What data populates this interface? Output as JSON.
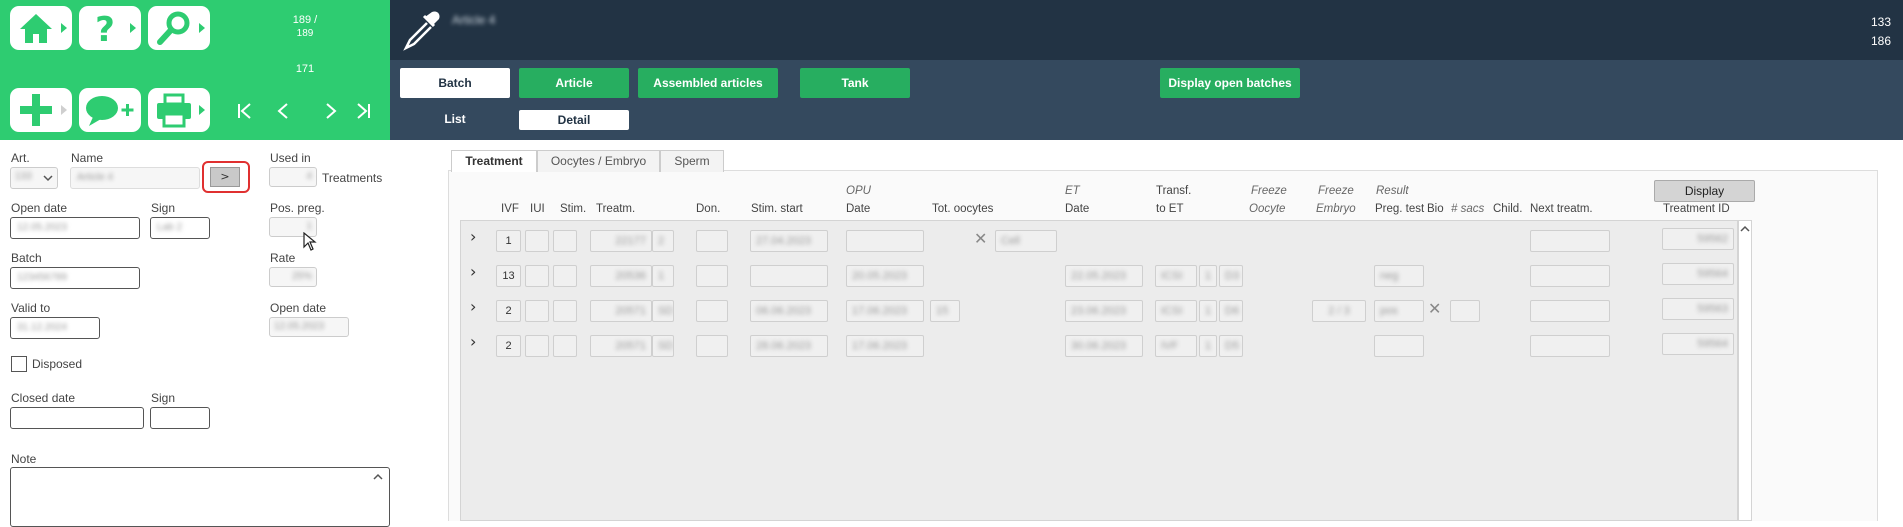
{
  "nav": {
    "counter_top": "189 /",
    "counter_mid": "189",
    "counter_bottom": "171",
    "pager": [
      "|<",
      "<",
      ">",
      ">|"
    ]
  },
  "header": {
    "title": "Article 4",
    "count_top": "133",
    "count_bottom": "186"
  },
  "tabs": {
    "batch": "Batch",
    "article": "Article",
    "assembled": "Assembled articles",
    "tank": "Tank",
    "display_open": "Display open batches",
    "list": "List",
    "detail": "Detail"
  },
  "form": {
    "art_label": "Art.",
    "art_value": "133",
    "name_label": "Name",
    "name_value": "Article 4",
    "go_button": ">",
    "used_in_label": "Used in",
    "used_in_value": "4",
    "treatments_label": "Treatments",
    "open_date_label": "Open date",
    "open_date_value": "12.05.2023",
    "sign_label": "Sign",
    "sign_value": "Lab 2",
    "pos_preg_label": "Pos. preg.",
    "pos_preg_value": "1",
    "batch_label": "Batch",
    "batch_value": "123456789",
    "rate_label": "Rate",
    "rate_value": "25%",
    "valid_to_label": "Valid to",
    "valid_to_value": "31.12.2024",
    "open_date2_label": "Open date",
    "open_date2_value": "12.05.2023",
    "disposed_label": "Disposed",
    "closed_date_label": "Closed date",
    "closed_sign_label": "Sign",
    "note_label": "Note"
  },
  "panel_tabs": [
    "Treatment",
    "Oocytes / Embryo",
    "Sperm"
  ],
  "grid": {
    "display_button": "Display",
    "headers": {
      "ivf": "IVF",
      "iui": "IUI",
      "stim": "Stim.",
      "treatm": "Treatm.",
      "don": "Don.",
      "stim_start": "Stim. start",
      "opu": "OPU",
      "date": "Date",
      "tot_oocytes": "Tot. oocytes",
      "et": "ET",
      "et_date": "Date",
      "transf": "Transf.",
      "to_et": "to ET",
      "freeze": "Freeze",
      "oocyte": "Oocyte",
      "freeze2": "Freeze",
      "embryo": "Embryo",
      "result": "Result",
      "preg_test": "Preg. test",
      "bio": "Bio",
      "sacs": "# sacs",
      "child": "Child.",
      "next_treatm": "Next treatm.",
      "treatment_id": "Treatment ID"
    },
    "rows": [
      {
        "ivf": "1",
        "treatm": "22177",
        "treatm_n": "2",
        "stim_start": "27.04.2023",
        "opu": "",
        "tot": "",
        "cell": "Cell",
        "et_date": "",
        "transf": "",
        "transf_n": "",
        "transf_d": "",
        "freeze": "",
        "preg": "",
        "tid": "59562"
      },
      {
        "ivf": "13",
        "treatm": "20536",
        "treatm_n": "1",
        "stim_start": "",
        "opu": "20.05.2023",
        "tot": "",
        "cell": "",
        "et_date": "22.05.2023",
        "transf": "ICSI",
        "transf_n": "1",
        "transf_d": "D3",
        "freeze": "",
        "preg": "neg",
        "tid": "59564"
      },
      {
        "ivf": "2",
        "treatm": "20571",
        "treatm_n": "SD",
        "stim_start": "06.06.2023",
        "opu": "17.06.2023",
        "tot": "15",
        "cell": "",
        "et_date": "23.06.2023",
        "transf": "ICSI",
        "transf_n": "1",
        "transf_d": "D6",
        "freeze": "2 / 3",
        "preg": "pos",
        "tid": "59563"
      },
      {
        "ivf": "2",
        "treatm": "20571",
        "treatm_n": "SD",
        "stim_start": "28.06.2023",
        "opu": "17.06.2023",
        "tot": "",
        "cell": "",
        "et_date": "30.06.2023",
        "transf": "IVF",
        "transf_n": "1",
        "transf_d": "D5",
        "freeze": "",
        "preg": "",
        "tid": "59564"
      }
    ]
  }
}
